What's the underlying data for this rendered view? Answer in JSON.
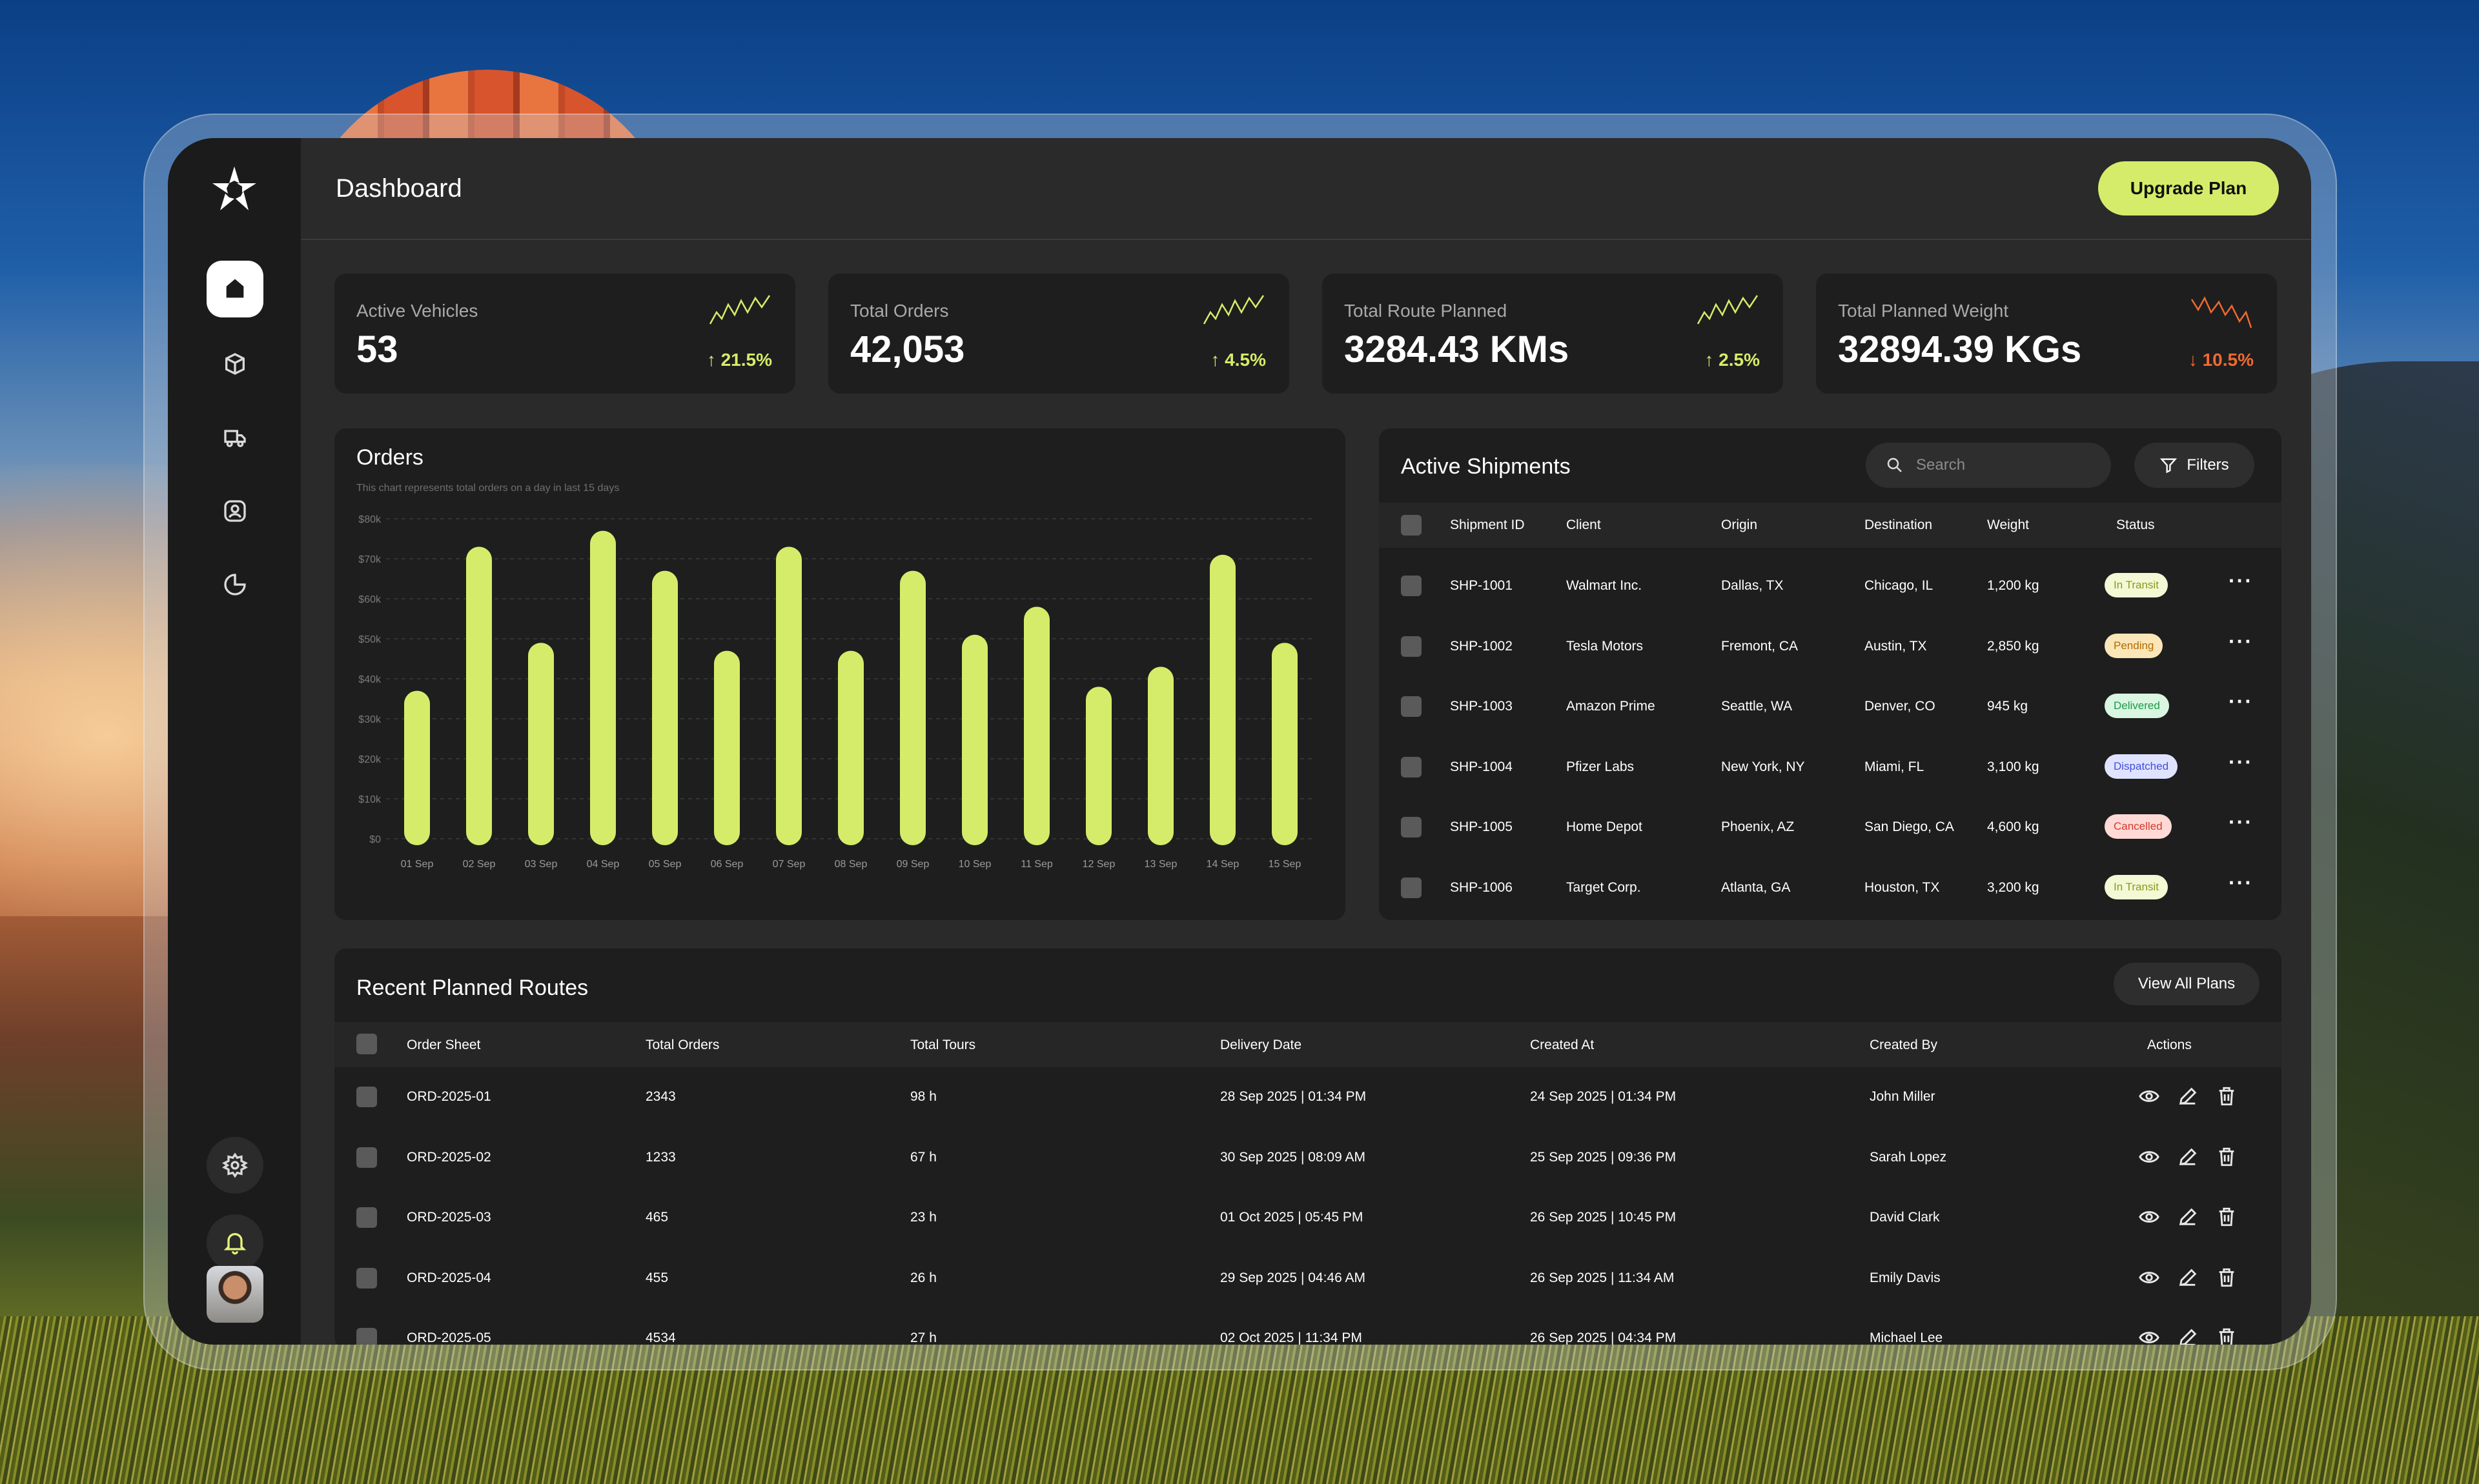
{
  "app": {
    "title": "Dashboard",
    "upgrade_label": "Upgrade Plan"
  },
  "sidebar": {
    "items": [
      {
        "icon": "home-icon",
        "active": true
      },
      {
        "icon": "box-icon",
        "active": false
      },
      {
        "icon": "truck-icon",
        "active": false
      },
      {
        "icon": "user-icon",
        "active": false
      },
      {
        "icon": "pie-chart-icon",
        "active": false
      }
    ],
    "bottom": [
      "gear-icon",
      "bell-icon",
      "avatar"
    ]
  },
  "kpis": [
    {
      "label": "Active Vehicles",
      "value": "53",
      "change": "↑ 21.5%",
      "trend": "up"
    },
    {
      "label": "Total Orders",
      "value": "42,053",
      "change": "↑ 4.5%",
      "trend": "up"
    },
    {
      "label": "Total Route Planned",
      "value": "3284.43 KMs",
      "change": "↑ 2.5%",
      "trend": "up"
    },
    {
      "label": "Total Planned Weight",
      "value": "32894.39 KGs",
      "change": "↓ 10.5%",
      "trend": "down"
    }
  ],
  "colors": {
    "accent": "#d5ec6a",
    "down": "#f06a30",
    "panel": "#1e1e1e",
    "app": "#2a2a2a"
  },
  "orders": {
    "title": "Orders",
    "subtitle": "This chart represents total orders on a day in last 15 days"
  },
  "chart_data": {
    "type": "bar",
    "categories": [
      "01 Sep",
      "02 Sep",
      "03 Sep",
      "04 Sep",
      "05 Sep",
      "06 Sep",
      "07 Sep",
      "08 Sep",
      "09 Sep",
      "10 Sep",
      "11 Sep",
      "12 Sep",
      "13 Sep",
      "14 Sep",
      "15 Sep"
    ],
    "values": [
      37000,
      73000,
      49000,
      77000,
      67000,
      47000,
      73000,
      47000,
      67000,
      51000,
      58000,
      38000,
      43000,
      71000,
      49000
    ],
    "ylim": [
      0,
      80000
    ],
    "yticks": [
      "$0",
      "$10k",
      "$20k",
      "$30k",
      "$40k",
      "$50k",
      "$60k",
      "$70k",
      "$80k"
    ],
    "title": "Orders",
    "color": "#d5ec6a",
    "grid": true
  },
  "shipments": {
    "title": "Active Shipments",
    "search_placeholder": "Search",
    "filters_label": "Filters",
    "headers": [
      "Shipment ID",
      "Client",
      "Origin",
      "Destination",
      "Weight",
      "Status"
    ],
    "rows": [
      {
        "id": "SHP-1001",
        "client": "Walmart Inc.",
        "origin": "Dallas, TX",
        "dest": "Chicago, IL",
        "weight": "1,200 kg",
        "status": "In Transit",
        "kind": "transit"
      },
      {
        "id": "SHP-1002",
        "client": "Tesla Motors",
        "origin": "Fremont, CA",
        "dest": "Austin, TX",
        "weight": "2,850 kg",
        "status": "Pending",
        "kind": "pending"
      },
      {
        "id": "SHP-1003",
        "client": "Amazon Prime",
        "origin": "Seattle, WA",
        "dest": "Denver, CO",
        "weight": "945 kg",
        "status": "Delivered",
        "kind": "delivered"
      },
      {
        "id": "SHP-1004",
        "client": "Pfizer Labs",
        "origin": "New York, NY",
        "dest": "Miami, FL",
        "weight": "3,100 kg",
        "status": "Dispatched",
        "kind": "dispatched"
      },
      {
        "id": "SHP-1005",
        "client": "Home Depot",
        "origin": "Phoenix, AZ",
        "dest": "San Diego, CA",
        "weight": "4,600 kg",
        "status": "Cancelled",
        "kind": "cancelled"
      },
      {
        "id": "SHP-1006",
        "client": "Target Corp.",
        "origin": "Atlanta, GA",
        "dest": "Houston, TX",
        "weight": "3,200 kg",
        "status": "In Transit",
        "kind": "transit"
      }
    ]
  },
  "routes": {
    "title": "Recent Planned Routes",
    "view_all_label": "View All Plans",
    "headers": [
      "Order Sheet",
      "Total Orders",
      "Total Tours",
      "Delivery Date",
      "Created At",
      "Created By",
      "Actions"
    ],
    "rows": [
      {
        "sheet": "ORD-2025-01",
        "orders": "2343",
        "tours": "98 h",
        "delivery": "28 Sep 2025 | 01:34 PM",
        "created": "24 Sep 2025 | 01:34 PM",
        "by": "John Miller"
      },
      {
        "sheet": "ORD-2025-02",
        "orders": "1233",
        "tours": "67 h",
        "delivery": "30 Sep 2025 | 08:09 AM",
        "created": "25 Sep 2025 | 09:36 PM",
        "by": "Sarah Lopez"
      },
      {
        "sheet": "ORD-2025-03",
        "orders": "465",
        "tours": "23 h",
        "delivery": "01 Oct 2025 | 05:45 PM",
        "created": "26 Sep 2025 | 10:45 PM",
        "by": "David Clark"
      },
      {
        "sheet": "ORD-2025-04",
        "orders": "455",
        "tours": "26 h",
        "delivery": "29 Sep 2025 | 04:46 AM",
        "created": "26 Sep 2025 | 11:34 AM",
        "by": "Emily Davis"
      },
      {
        "sheet": "ORD-2025-05",
        "orders": "4534",
        "tours": "27 h",
        "delivery": "02 Oct 2025 | 11:34 PM",
        "created": "26 Sep 2025 | 04:34 PM",
        "by": "Michael Lee"
      }
    ]
  }
}
